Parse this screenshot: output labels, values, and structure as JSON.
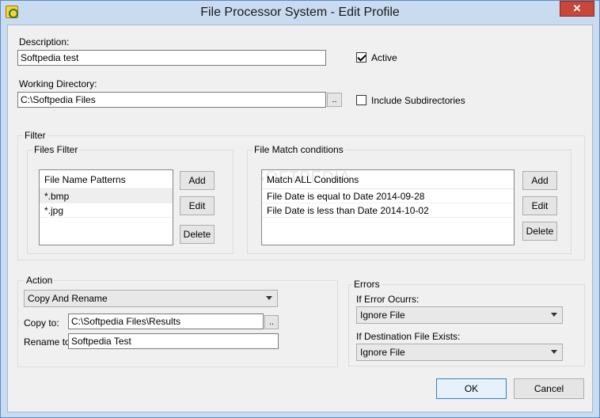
{
  "window": {
    "title": "File Processor System - Edit Profile",
    "close_label": "✕"
  },
  "description": {
    "label": "Description:",
    "value": "Softpedia test"
  },
  "active": {
    "label": "Active",
    "checked": true
  },
  "working_directory": {
    "label": "Working Directory:",
    "value": "C:\\Softpedia Files",
    "browse_label": ".."
  },
  "include_subdirs": {
    "label": "Include Subdirectories",
    "checked": false
  },
  "filter": {
    "legend": "Filter",
    "files_filter": {
      "legend": "Files Filter",
      "header": "File Name Patterns",
      "items": [
        "*.bmp",
        "*.jpg"
      ],
      "add_label": "Add",
      "edit_label": "Edit",
      "delete_label": "Delete"
    },
    "match_conditions": {
      "legend": "File Match conditions",
      "header": "Match ALL Conditions",
      "items": [
        "File Date is equal to Date 2014-09-28",
        "File Date is less than Date 2014-10-02"
      ],
      "add_label": "Add",
      "edit_label": "Edit",
      "delete_label": "Delete",
      "watermark": "SOFTPEDIA"
    }
  },
  "action": {
    "legend": "Action",
    "selected": "Copy And Rename",
    "copy_to": {
      "label": "Copy to:",
      "value": "C:\\Softpedia Files\\Results",
      "browse_label": ".."
    },
    "rename_to": {
      "label": "Rename to:",
      "value": "Softpedia Test"
    }
  },
  "errors": {
    "legend": "Errors",
    "if_error": {
      "label": "If Error Ocurrs:",
      "selected": "Ignore File"
    },
    "if_exists": {
      "label": "If Destination File Exists:",
      "selected": "Ignore File"
    }
  },
  "buttons": {
    "ok_label": "OK",
    "cancel_label": "Cancel"
  }
}
